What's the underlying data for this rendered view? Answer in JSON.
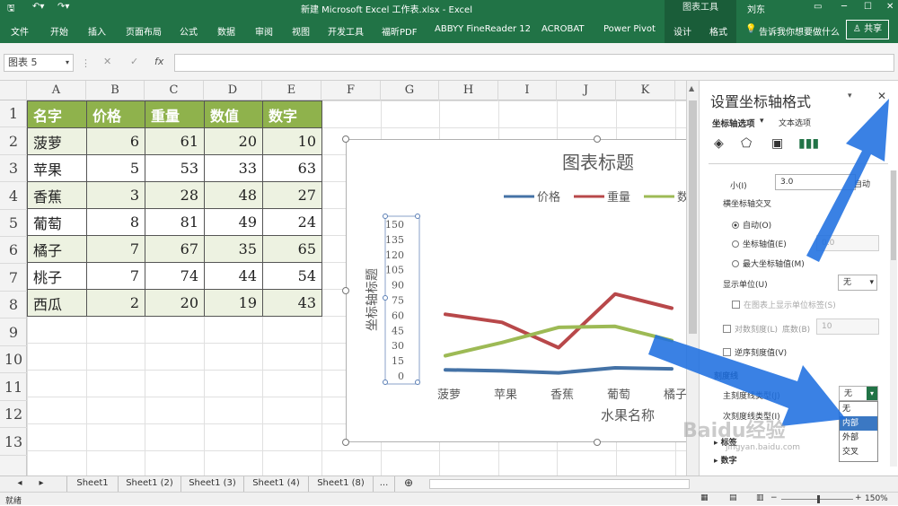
{
  "title_bar": {
    "title": "新建 Microsoft Excel 工作表.xlsx  -  Excel",
    "context_group": "图表工具",
    "user": "刘东"
  },
  "ribbon": {
    "tabs": [
      "文件",
      "开始",
      "插入",
      "页面布局",
      "公式",
      "数据",
      "审阅",
      "视图",
      "开发工具",
      "福昕PDF",
      "ABBYY FineReader 12",
      "ACROBAT",
      "Power Pivot",
      "设计",
      "格式"
    ],
    "tell_me": "告诉我你想要做什么",
    "share": "共享"
  },
  "formula_bar": {
    "name_box": "图表 5",
    "fx": "fx",
    "value": ""
  },
  "columns": [
    "A",
    "B",
    "C",
    "D",
    "E",
    "F",
    "G",
    "H",
    "I",
    "J",
    "K"
  ],
  "rows": [
    "1",
    "2",
    "3",
    "4",
    "5",
    "6",
    "7",
    "8",
    "9",
    "10",
    "11",
    "12",
    "13"
  ],
  "table": {
    "header": [
      "名字",
      "价格",
      "重量",
      "数值",
      "数字"
    ],
    "rows": [
      [
        "菠萝",
        "6",
        "61",
        "20",
        "10"
      ],
      [
        "苹果",
        "5",
        "53",
        "33",
        "63"
      ],
      [
        "香蕉",
        "3",
        "28",
        "48",
        "27"
      ],
      [
        "葡萄",
        "8",
        "81",
        "49",
        "24"
      ],
      [
        "橘子",
        "7",
        "67",
        "35",
        "65"
      ],
      [
        "桃子",
        "7",
        "74",
        "44",
        "54"
      ],
      [
        "西瓜",
        "2",
        "20",
        "19",
        "43"
      ]
    ]
  },
  "chart_data": {
    "type": "line",
    "title": "图表标题",
    "xlabel": "水果名称",
    "ylabel": "坐标轴标题",
    "categories": [
      "菠萝",
      "苹果",
      "香蕉",
      "葡萄",
      "橘子"
    ],
    "series": [
      {
        "name": "价格",
        "color": "#4472a6",
        "values": [
          6,
          5,
          3,
          8,
          7
        ]
      },
      {
        "name": "重量",
        "color": "#b8484a",
        "values": [
          61,
          53,
          28,
          81,
          67
        ]
      },
      {
        "name": "数值",
        "color": "#9dba55",
        "values": [
          20,
          33,
          48,
          49,
          35
        ]
      }
    ],
    "legend_labels": [
      "价格",
      "重量",
      "数"
    ],
    "y_ticks": [
      "150",
      "135",
      "120",
      "105",
      "90",
      "75",
      "60",
      "45",
      "30",
      "15",
      "0"
    ],
    "ylim": [
      0,
      150
    ],
    "legend": "top"
  },
  "pane": {
    "title": "设置坐标轴格式",
    "tab_axis": "坐标轴选项",
    "tab_text": "文本选项",
    "min_label": "小(I)",
    "min_value": "3.0",
    "min_auto": "自动",
    "cross_label": "横坐标轴交叉",
    "auto": "自动(O)",
    "axis_value": "坐标轴值(E)",
    "axis_value_input": "0.0",
    "max_value": "最大坐标轴值(M)",
    "display_units": "显示单位(U)",
    "display_units_value": "无",
    "show_units_label": "在图表上显示单位标签(S)",
    "log_scale": "对数刻度(L)",
    "base": "底数(B)",
    "base_value": "10",
    "reverse": "逆序刻度值(V)",
    "tick_marks": "刻度线",
    "major_tick": "主刻度线类型(J)",
    "major_tick_value": "无",
    "minor_tick": "次刻度线类型(I)",
    "options": [
      "无",
      "内部",
      "外部",
      "交叉"
    ],
    "labels_section": "标签",
    "numbers_section": "数字"
  },
  "sheets": [
    "Sheet1",
    "Sheet1 (2)",
    "Sheet1 (3)",
    "Sheet1 (4)",
    "Sheet1 (8)",
    "..."
  ],
  "status": {
    "mode": "就绪",
    "zoom": "150%"
  },
  "watermark": "Baidu经验",
  "watermark_url": "jingyan.baidu.com"
}
